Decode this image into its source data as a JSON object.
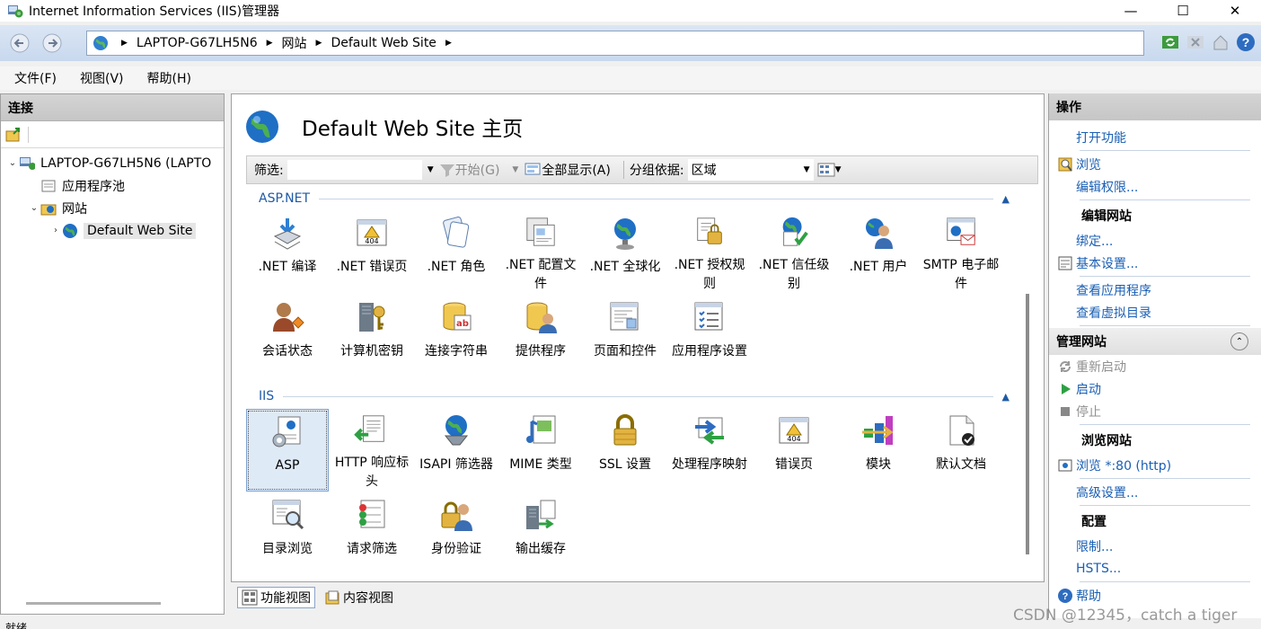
{
  "window": {
    "title": "Internet Information Services (IIS)管理器",
    "minimize": "—",
    "maximize": "☐",
    "close": "✕"
  },
  "address": {
    "crumbs": [
      "LAPTOP-G67LH5N6",
      "网站",
      "Default Web Site"
    ]
  },
  "menu": [
    "文件(F)",
    "视图(V)",
    "帮助(H)"
  ],
  "connections": {
    "title": "连接",
    "tree": [
      {
        "label": "LAPTOP-G67LH5N6 (LAPTO",
        "toggle": "⌄",
        "indent": 0
      },
      {
        "label": "应用程序池",
        "toggle": "",
        "indent": 1
      },
      {
        "label": "网站",
        "toggle": "⌄",
        "indent": 1
      },
      {
        "label": "Default Web Site",
        "toggle": "›",
        "indent": 2,
        "selected": true
      }
    ]
  },
  "main": {
    "title": "Default Web Site 主页",
    "filter_label": "筛选:",
    "start_label": "开始(G)",
    "show_all_label": "全部显示(A)",
    "group_by_label": "分组依据:",
    "group_by_value": "区域",
    "groups": [
      {
        "name": "ASP.NET",
        "features": [
          {
            "label": ".NET 编译",
            "icon": "compile-icon"
          },
          {
            "label": ".NET 错误页",
            "icon": "error-404-icon"
          },
          {
            "label": ".NET 角色",
            "icon": "roles-icon"
          },
          {
            "label": ".NET 配置文件",
            "icon": "profile-icon"
          },
          {
            "label": ".NET 全球化",
            "icon": "globalization-icon"
          },
          {
            "label": ".NET 授权规则",
            "icon": "authorization-icon"
          },
          {
            "label": ".NET 信任级别",
            "icon": "trust-icon"
          },
          {
            "label": ".NET 用户",
            "icon": "users-icon"
          },
          {
            "label": "SMTP 电子邮件",
            "icon": "smtp-icon"
          },
          {
            "label": "会话状态",
            "icon": "session-icon"
          },
          {
            "label": "计算机密钥",
            "icon": "machine-key-icon"
          },
          {
            "label": "连接字符串",
            "icon": "connection-string-icon"
          },
          {
            "label": "提供程序",
            "icon": "providers-icon"
          },
          {
            "label": "页面和控件",
            "icon": "pages-controls-icon"
          },
          {
            "label": "应用程序设置",
            "icon": "app-settings-icon"
          }
        ]
      },
      {
        "name": "IIS",
        "features": [
          {
            "label": "ASP",
            "icon": "asp-icon",
            "selected": true
          },
          {
            "label": "HTTP 响应标头",
            "icon": "http-headers-icon"
          },
          {
            "label": "ISAPI 筛选器",
            "icon": "isapi-icon"
          },
          {
            "label": "MIME 类型",
            "icon": "mime-icon"
          },
          {
            "label": "SSL 设置",
            "icon": "ssl-lock-icon"
          },
          {
            "label": "处理程序映射",
            "icon": "handler-mappings-icon"
          },
          {
            "label": "错误页",
            "icon": "error-page-icon"
          },
          {
            "label": "模块",
            "icon": "modules-icon"
          },
          {
            "label": "默认文档",
            "icon": "default-document-icon"
          },
          {
            "label": "目录浏览",
            "icon": "directory-browsing-icon"
          },
          {
            "label": "请求筛选",
            "icon": "request-filtering-icon"
          },
          {
            "label": "身份验证",
            "icon": "authentication-icon"
          },
          {
            "label": "输出缓存",
            "icon": "output-cache-icon"
          }
        ]
      }
    ],
    "view_tabs": [
      "功能视图",
      "内容视图"
    ]
  },
  "actions": {
    "title": "操作",
    "sections": [
      {
        "title": "",
        "items": [
          {
            "label": "打开功能",
            "icon": ""
          }
        ]
      },
      {
        "title": "",
        "items": [
          {
            "label": "浏览",
            "icon": "browse-icon"
          },
          {
            "label": "编辑权限...",
            "icon": ""
          }
        ]
      },
      {
        "title": "编辑网站",
        "items": [
          {
            "label": "绑定...",
            "icon": ""
          },
          {
            "label": "基本设置...",
            "icon": "settings-icon"
          }
        ]
      },
      {
        "title": "",
        "items": [
          {
            "label": "查看应用程序",
            "icon": ""
          },
          {
            "label": "查看虚拟目录",
            "icon": ""
          }
        ]
      },
      {
        "title": "管理网站",
        "band": true,
        "collapse": "⌃",
        "items": [
          {
            "label": "重新启动",
            "icon": "restart-icon",
            "disabled": true
          },
          {
            "label": "启动",
            "icon": "start-icon"
          },
          {
            "label": "停止",
            "icon": "stop-icon",
            "disabled": true
          }
        ]
      },
      {
        "title": "浏览网站",
        "items": [
          {
            "label": "浏览 *:80 (http)",
            "icon": "browse-port-icon"
          }
        ]
      },
      {
        "title": "",
        "items": [
          {
            "label": "高级设置...",
            "icon": ""
          }
        ]
      },
      {
        "title": "配置",
        "items": [
          {
            "label": "限制...",
            "icon": ""
          },
          {
            "label": "HSTS...",
            "icon": ""
          }
        ]
      },
      {
        "title": "",
        "items": [
          {
            "label": "帮助",
            "icon": "help-icon"
          }
        ]
      }
    ]
  },
  "status": "就绪",
  "watermark": "CSDN @12345，catch a tiger",
  "colors": {
    "link": "#1a5fb4",
    "group_heading": "#1f5aa5",
    "selection": "#dfeaf7"
  }
}
